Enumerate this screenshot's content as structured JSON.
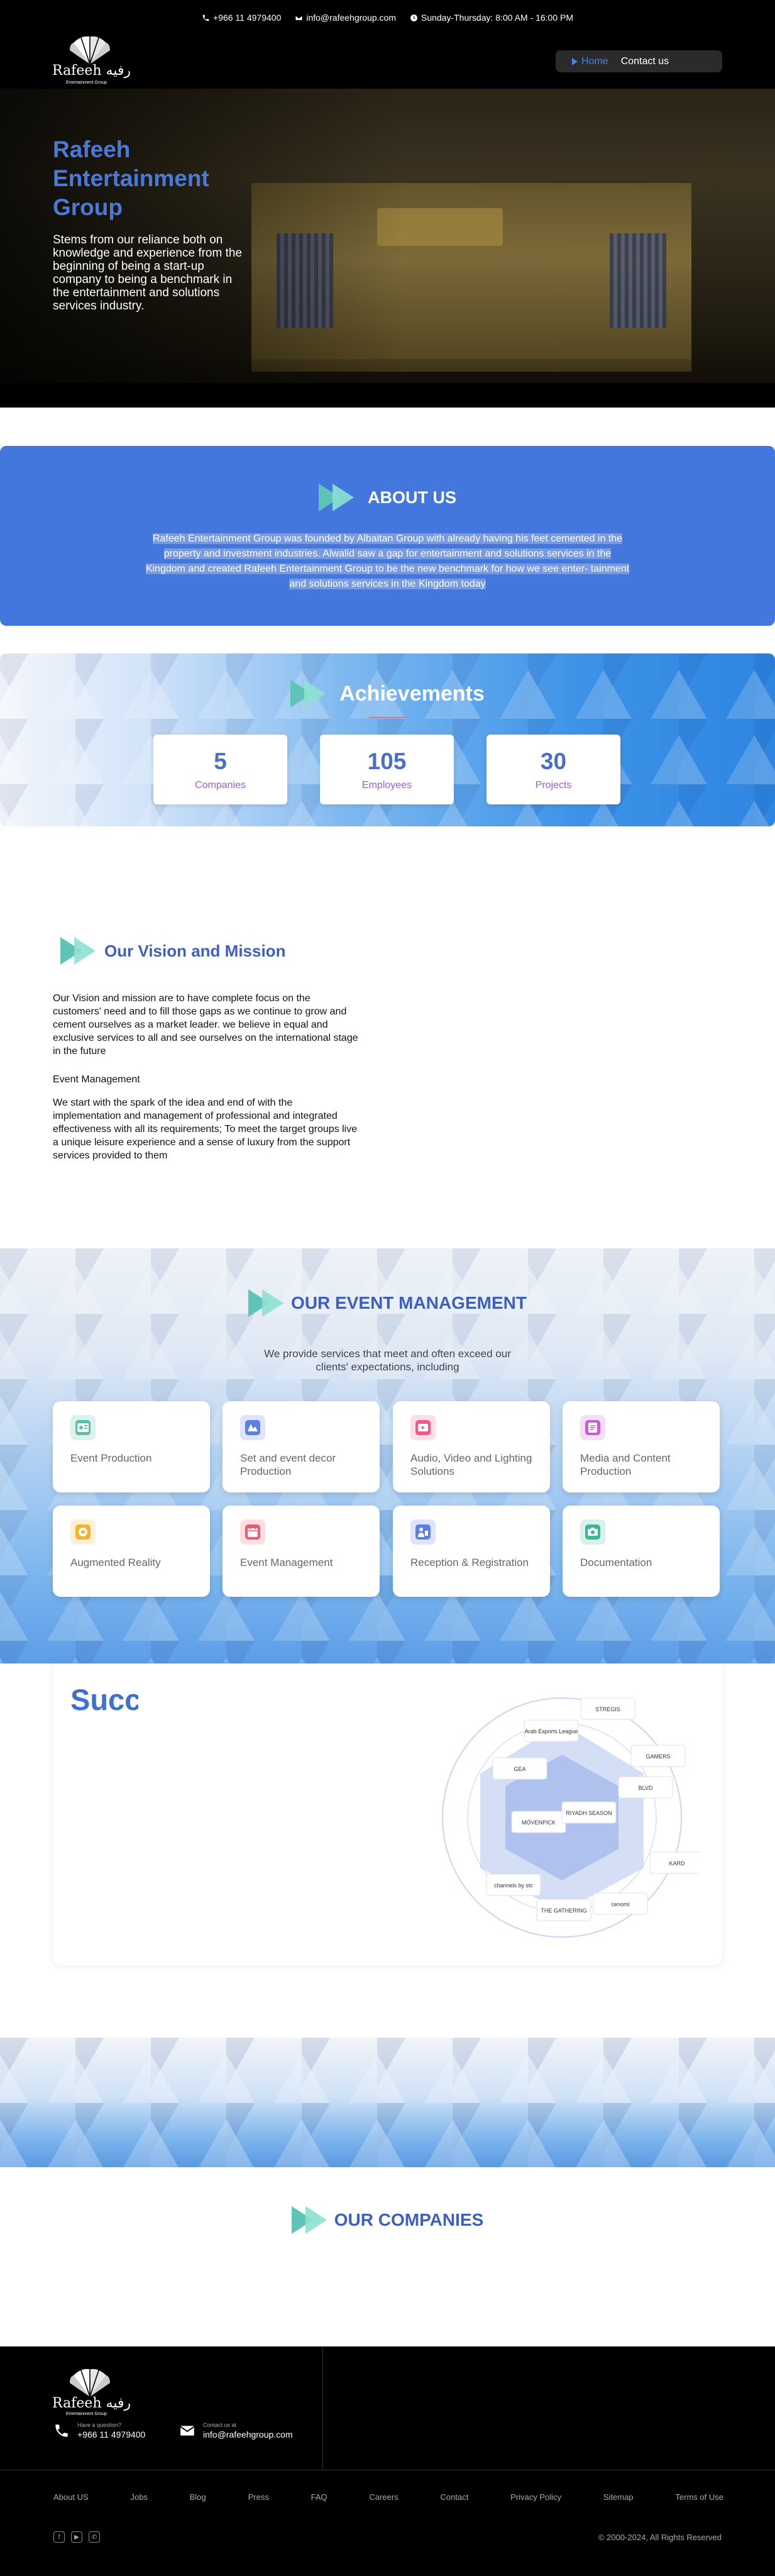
{
  "topbar": {
    "phone": "+966 11 4979400",
    "email": "info@rafeehgroup.com",
    "hours": "Sunday-Thursday: 8:00 AM - 16:00 PM"
  },
  "logo": {
    "brand": "Rafeeh رفيه",
    "sub": "Entertainment Group"
  },
  "nav": {
    "home": "Home",
    "contact": "Contact us"
  },
  "hero": {
    "title": "Rafeeh Entertainment Group",
    "text": "Stems from our reliance both on knowledge and experience from the beginning of being a start-up company to being a benchmark in the entertainment and solutions services industry."
  },
  "about": {
    "title": "ABOUT US",
    "text": "Rafeeh Entertainment Group was founded by Albaitan Group with already having his feet cemented in the property and investment industries. Alwalid saw a gap for entertainment and solutions services in the Kingdom and created Rafeeh Entertainment Group to be the new benchmark for how we see enter- tainment and solutions services in the Kingdom today"
  },
  "achievements": {
    "title": "Achievements",
    "stats": [
      {
        "value": "5",
        "label": "Companies"
      },
      {
        "value": "105",
        "label": "Employees"
      },
      {
        "value": "30",
        "label": "Projects"
      }
    ]
  },
  "vision": {
    "title": "Our Vision and Mission",
    "p1": "Our Vision and mission are to have complete focus on the customers' need and to fill those gaps as we continue to grow and cement ourselves as a market leader. we believe in equal and exclusive services to all and see ourselves on the international stage in the future",
    "subheading": "Event Management",
    "p2": "We start with the spark of the idea and end of with the implementation and management of professional and integrated effectiveness with all its requirements; To meet the target groups live a unique leisure experience and a sense of luxury from the support services provided to them"
  },
  "events": {
    "title": "OUR EVENT MANAGEMENT",
    "subtitle": "We provide services that meet and often exceed our clients' expectations, including",
    "services": [
      {
        "name": "Event Production",
        "icon": "production-icon",
        "color": "#5bbfa5"
      },
      {
        "name": "Set and event decor Production",
        "icon": "decor-icon",
        "color": "#5b7fe6"
      },
      {
        "name": "Audio, Video and Lighting Solutions",
        "icon": "audio-video-icon",
        "color": "#ef5a8a"
      },
      {
        "name": "Media and Content Production",
        "icon": "media-icon",
        "color": "#c95bd6"
      },
      {
        "name": "Augmented Reality",
        "icon": "ar-icon",
        "color": "#f2b331"
      },
      {
        "name": "Event Management",
        "icon": "event-icon",
        "color": "#ef5a72"
      },
      {
        "name": "Reception & Registration",
        "icon": "reception-icon",
        "color": "#5b7fe6"
      },
      {
        "name": "Documentation",
        "icon": "documentation-icon",
        "color": "#3fb59a"
      }
    ]
  },
  "partners": {
    "title": "Success Partners",
    "logos": [
      "STREGIS",
      "Arab Esports League",
      "GAMERS",
      "BLVD",
      "GEA",
      "MÖVENPICK",
      "RIYADH SEASON",
      "channels by stc",
      "THE GATHERING",
      "cenomi",
      "KARD"
    ]
  },
  "companies": {
    "title": "OUR COMPANIES"
  },
  "footer": {
    "phone_label": "Have a question?",
    "phone": "+966 11 4979400",
    "email_label": "Contact us at",
    "email": "info@rafeehgroup.com",
    "links": [
      "About US",
      "Jobs",
      "Blog",
      "Press",
      "FAQ",
      "Careers",
      "Contact",
      "Privacy Policy",
      "Sitemap",
      "Terms of Use"
    ],
    "copyright": "© 2000-2024, All Rights Reserved"
  },
  "colors": {
    "accent": "#4477dd",
    "teal": "#5fc4b8",
    "purple": "#9c5fd0"
  }
}
